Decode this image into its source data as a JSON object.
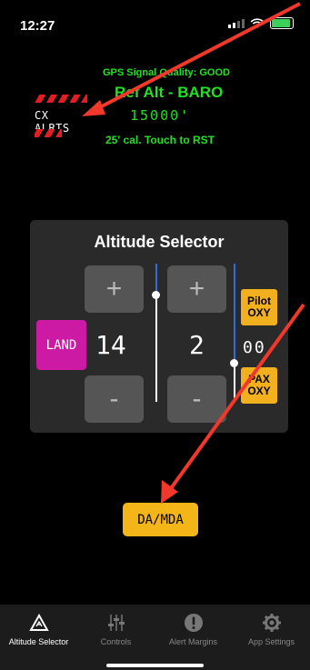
{
  "status": {
    "time": "12:27"
  },
  "header": {
    "gps_signal": "GPS Signal Quality: GOOD",
    "ref_alt_title": "Ref Alt - BARO",
    "ref_alt_value": "15000'",
    "calibration_text": "25' cal. Touch to RST",
    "cx_alerts_label": "CX ALRTS"
  },
  "altitude_selector": {
    "title": "Altitude Selector",
    "land_label": "LAND",
    "thousands_value": "14",
    "hundreds_value": "2",
    "plus_label": "+",
    "minus_label": "-",
    "pilot_oxy_line1": "Pilot",
    "pilot_oxy_line2": "OXY",
    "pax_oxy_line1": "PAX",
    "pax_oxy_line2": "OXY",
    "oxy_digits": "00"
  },
  "da_mda_label": "DA/MDA",
  "tabs": [
    {
      "label": "Altitude Selector",
      "icon": "altitude-warning-icon",
      "active": true
    },
    {
      "label": "Controls",
      "icon": "sliders-icon",
      "active": false
    },
    {
      "label": "Alert Margins",
      "icon": "exclamation-circle-icon",
      "active": false
    },
    {
      "label": "App Settings",
      "icon": "gear-icon",
      "active": false
    }
  ],
  "colors": {
    "accent_green": "#22e022",
    "land_magenta": "#cc1aa4",
    "button_yellow": "#f4b519",
    "alert_red": "#e41c24",
    "annotation_arrow": "#f2372b"
  }
}
